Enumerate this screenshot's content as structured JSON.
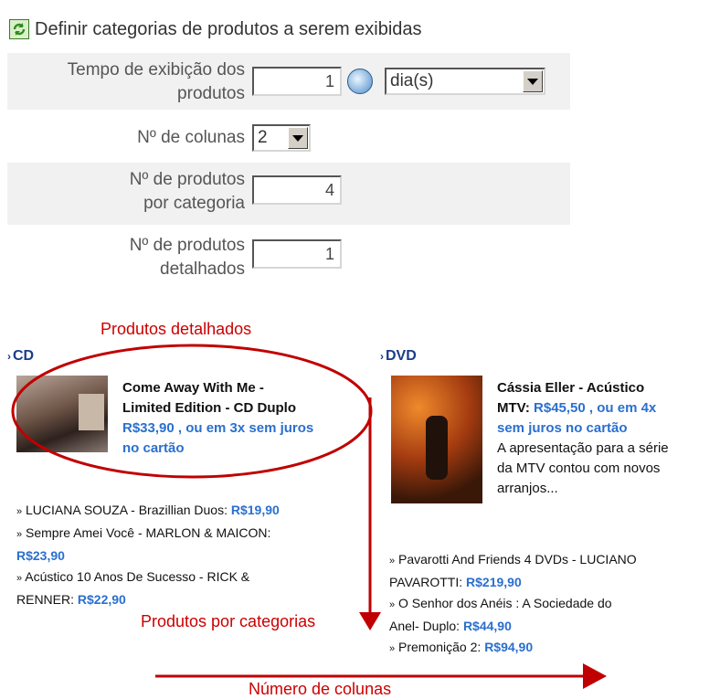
{
  "header": {
    "title": "Definir categorias de produtos a serem exibidas",
    "icon": "refresh-icon"
  },
  "form": {
    "display_time": {
      "label_line1": "Tempo de exibição dos",
      "label_line2": "produtos",
      "value": "1",
      "unit": "dia(s)"
    },
    "columns": {
      "label": "Nº de colunas",
      "value": "2"
    },
    "products_per_category": {
      "label_line1": "Nº de produtos",
      "label_line2": "por categoria",
      "value": "4"
    },
    "detailed_products": {
      "label_line1": "Nº de produtos",
      "label_line2": "detalhados",
      "value": "1"
    }
  },
  "annotations": {
    "detailed": "Produtos detalhados",
    "per_category": "Produtos por categorias",
    "columns": "Número de colunas",
    "color": "#cc0000"
  },
  "preview": {
    "cd": {
      "title": "CD",
      "featured": {
        "name_line1": "Come Away With Me -",
        "name_line2": "Limited Edition - CD Duplo",
        "price_line1": "R$33,90 , ou em 3x sem juros",
        "price_line2": "no cartão"
      },
      "items": [
        {
          "name": "LUCIANA SOUZA - Brazillian Duos:",
          "price": "R$19,90"
        },
        {
          "name": "Sempre Amei Você - MARLON & MAICON:",
          "price": "R$23,90"
        },
        {
          "name_line1": "Acústico 10 Anos De Sucesso - RICK &",
          "name_line2": "RENNER:",
          "price": "R$22,90"
        }
      ]
    },
    "dvd": {
      "title": "DVD",
      "featured": {
        "name_line1": "Cássia Eller - Acústico",
        "name_line2": "MTV:",
        "price_line1": "R$45,50 , ou em 4x",
        "price_line2": "sem juros no cartão",
        "desc_line1": "A apresentação para a série",
        "desc_line2": "da MTV contou com novos",
        "desc_line3": "arranjos..."
      },
      "items": [
        {
          "name_line1": "Pavarotti And Friends 4 DVDs - LUCIANO",
          "name_line2": "PAVAROTTI:",
          "price": "R$219,90"
        },
        {
          "name_line1": "O Senhor dos Anéis : A Sociedade do",
          "name_line2": "Anel- Duplo:",
          "price": "R$44,90"
        },
        {
          "name": "Premonição 2:",
          "price": "R$94,90"
        }
      ]
    }
  }
}
